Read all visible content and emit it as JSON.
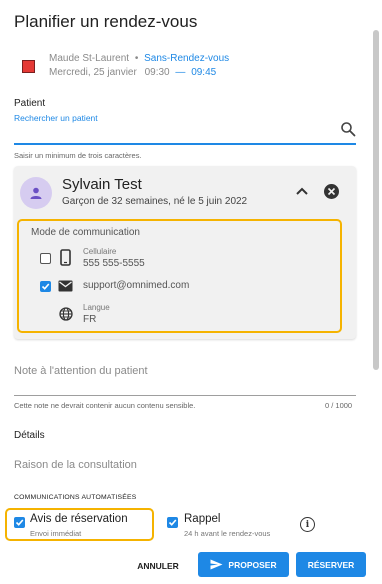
{
  "dialog": {
    "title": "Planifier un rendez-vous"
  },
  "event": {
    "location": "Maude St-Laurent",
    "separator": "•",
    "type": "Sans-Rendez-vous",
    "date": "Mercredi, 25 janvier",
    "start": "09:30",
    "dash": "—",
    "end": "09:45",
    "color": "#e53935"
  },
  "patient_field": {
    "label": "Patient",
    "search_placeholder": "Rechercher un patient",
    "hint": "Saisir un minimum de trois caractères."
  },
  "patient": {
    "name": "Sylvain Test",
    "subtitle": "Garçon de 32 semaines, né le 5 juin 2022",
    "communication": {
      "title": "Mode de communication",
      "phone_label": "Cellulaire",
      "phone_value": "555 555-5555",
      "phone_checked": false,
      "email_value": "support@omnimed.com",
      "email_checked": true,
      "language_label": "Langue",
      "language_value": "FR"
    }
  },
  "note": {
    "placeholder": "Note à l'attention du patient",
    "hint": "Cette note ne devrait contenir aucun contenu sensible.",
    "counter": "0 / 1000"
  },
  "details": {
    "title": "Détails",
    "reason_placeholder": "Raison de la consultation"
  },
  "automated": {
    "title": "COMMUNICATIONS AUTOMATISÉES",
    "booking_label": "Avis de réservation",
    "booking_sub": "Envoi immédiat",
    "booking_checked": true,
    "reminder_label": "Rappel",
    "reminder_sub": "24 h avant le rendez-vous",
    "reminder_checked": true
  },
  "actions": {
    "cancel": "ANNULER",
    "propose": "PROPOSER",
    "reserve": "RÉSERVER"
  },
  "colors": {
    "accent": "#1e88e5",
    "highlight": "#f5b300"
  }
}
